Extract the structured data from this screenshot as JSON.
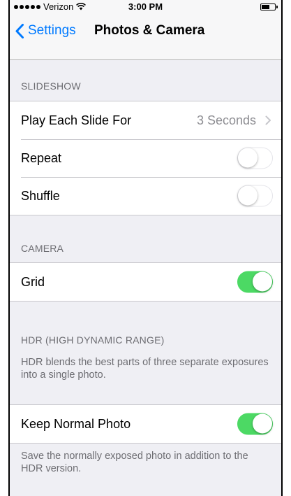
{
  "status_bar": {
    "carrier": "Verizon",
    "time": "3:00 PM"
  },
  "nav": {
    "back_label": "Settings",
    "title": "Photos & Camera"
  },
  "slideshow": {
    "header": "SLIDESHOW",
    "play_each_slide_label": "Play Each Slide For",
    "play_each_slide_value": "3 Seconds",
    "repeat_label": "Repeat",
    "repeat_on": false,
    "shuffle_label": "Shuffle",
    "shuffle_on": false
  },
  "camera": {
    "header": "CAMERA",
    "grid_label": "Grid",
    "grid_on": true
  },
  "hdr": {
    "header": "HDR (HIGH DYNAMIC RANGE)",
    "description": "HDR blends the best parts of three separate exposures into a single photo.",
    "keep_normal_label": "Keep Normal Photo",
    "keep_normal_on": true,
    "keep_normal_footer": "Save the normally exposed photo in addition to the HDR version."
  },
  "colors": {
    "accent": "#007aff",
    "toggle_on": "#4cd964",
    "background": "#efeff4"
  }
}
